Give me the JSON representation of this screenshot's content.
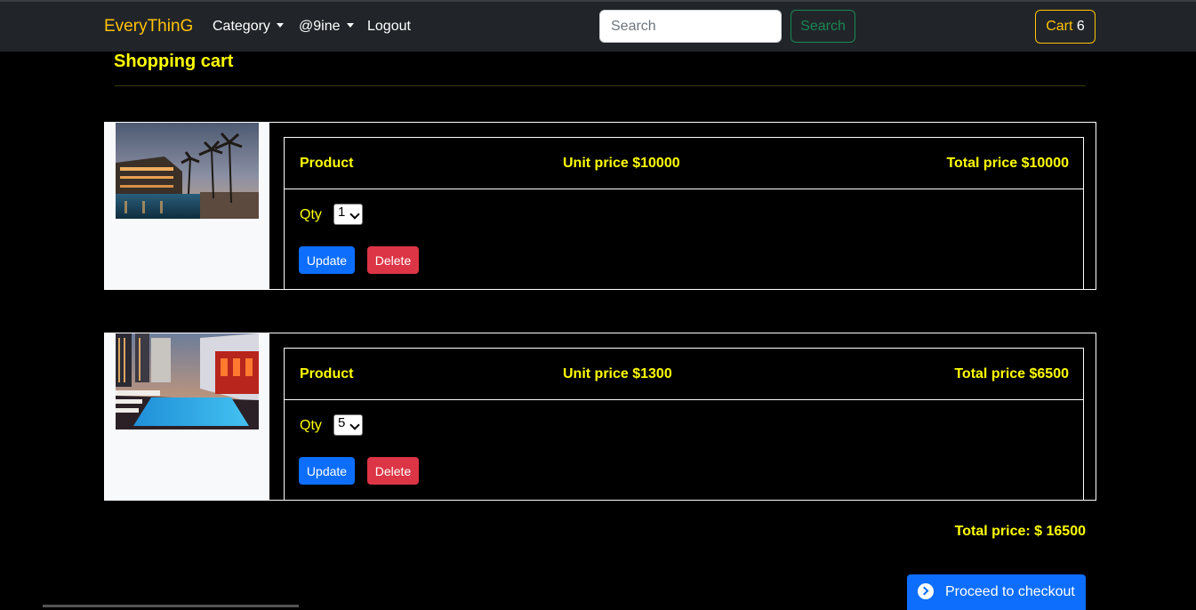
{
  "navbar": {
    "brand": "EveryThinG",
    "category_label": "Category",
    "user_label": "@9ine",
    "logout_label": "Logout",
    "search_placeholder": "Search",
    "search_button": "Search",
    "cart_label": "Cart",
    "cart_count": "6"
  },
  "page": {
    "title": "Shopping cart"
  },
  "cart_items": [
    {
      "product_label": "Product",
      "unit_price": "Unit price $10000",
      "total_price": "Total price $10000",
      "qty_label": "Qty",
      "qty": "1",
      "update_label": "Update",
      "delete_label": "Delete",
      "image_icon": "hotel-pool-night-photo"
    },
    {
      "product_label": "Product",
      "unit_price": "Unit price $1300",
      "total_price": "Total price $6500",
      "qty_label": "Qty",
      "qty": "5",
      "update_label": "Update",
      "delete_label": "Delete",
      "image_icon": "rooftop-pool-photo"
    }
  ],
  "summary": {
    "grand_total": "Total price: $ 16500",
    "checkout_label": "Proceed to checkout"
  },
  "colors": {
    "accent_yellow": "#ffff00",
    "brand_amber": "#ffc107",
    "primary_blue": "#0d6efd",
    "danger_red": "#dc3545",
    "success_green": "#198754",
    "navbar_bg": "#212529"
  }
}
